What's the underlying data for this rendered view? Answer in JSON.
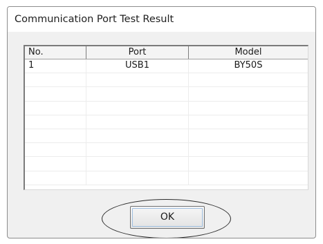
{
  "window": {
    "title": "Communication Port Test Result"
  },
  "table": {
    "columns": [
      "No.",
      "Port",
      "Model"
    ],
    "rows": [
      {
        "no": "1",
        "port": "USB1",
        "model": "BY50S"
      },
      {
        "no": "",
        "port": "",
        "model": ""
      },
      {
        "no": "",
        "port": "",
        "model": ""
      },
      {
        "no": "",
        "port": "",
        "model": ""
      },
      {
        "no": "",
        "port": "",
        "model": ""
      },
      {
        "no": "",
        "port": "",
        "model": ""
      },
      {
        "no": "",
        "port": "",
        "model": ""
      },
      {
        "no": "",
        "port": "",
        "model": ""
      },
      {
        "no": "",
        "port": "",
        "model": ""
      }
    ]
  },
  "buttons": {
    "ok_label": "OK"
  },
  "colors": {
    "dialog_background": "#f0f0f0",
    "titlebar_background": "#ffffff",
    "annotation_outline": "#2a2a2a"
  }
}
